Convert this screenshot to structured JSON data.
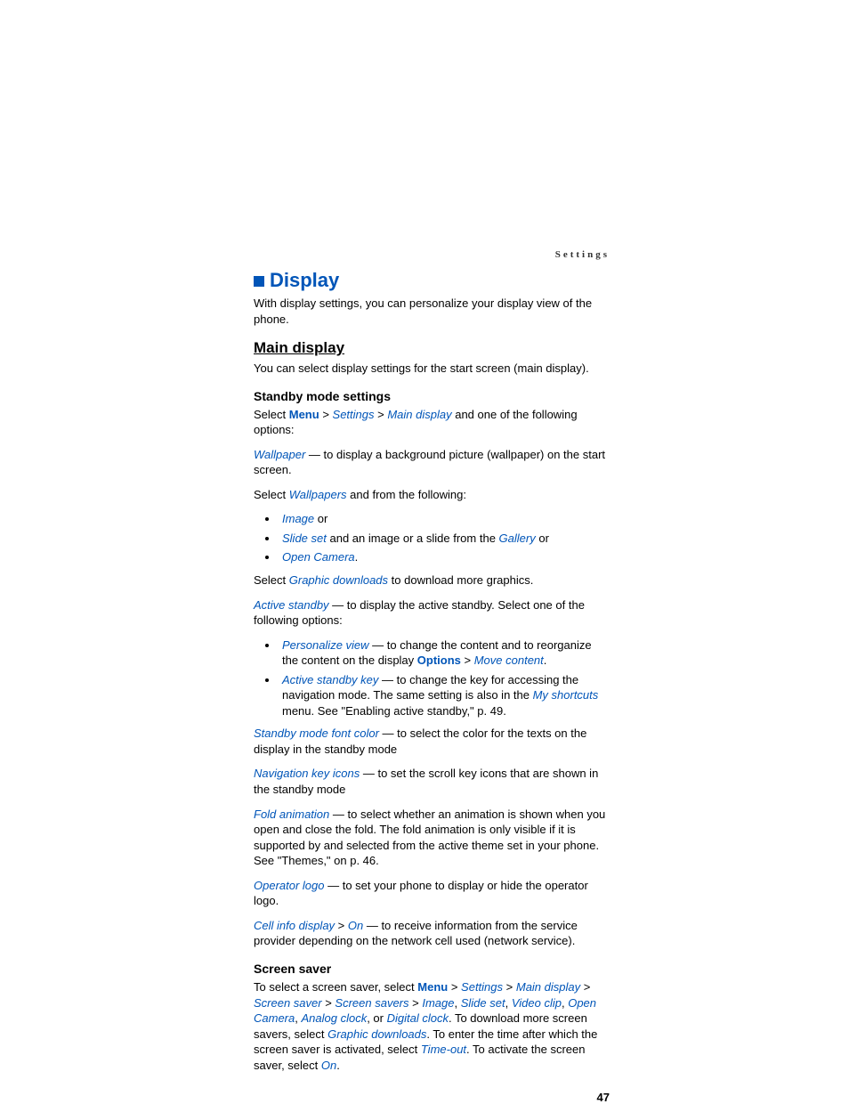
{
  "header": {
    "running": "Settings"
  },
  "title": {
    "main": "Display",
    "intro": "With display settings, you can personalize your display view of the phone."
  },
  "mainDisplay": {
    "heading": "Main display",
    "intro": "You can select display settings for the start screen (main display)."
  },
  "standby": {
    "heading": "Standby mode settings",
    "select_prefix": "Select ",
    "menu": "Menu",
    "settings": "Settings",
    "main_display": "Main display",
    "select_suffix": " and one of the following options:",
    "wallpaper": "Wallpaper",
    "wallpaper_desc": " — to display a background picture (wallpaper) on the start screen.",
    "wallpapers_select_prefix": " Select ",
    "wallpapers": "Wallpapers",
    "wallpapers_select_suffix": " and from the following:",
    "li1_image": "Image",
    "li1_or": " or",
    "li2_slideset": "Slide set",
    "li2_mid": " and an image or a slide from the ",
    "li2_gallery": "Gallery",
    "li2_or": " or",
    "li3_open_camera": "Open Camera",
    "gdl_prefix": "Select ",
    "graphic_downloads": "Graphic downloads",
    "gdl_suffix": " to download more graphics.",
    "active_standby": "Active standby",
    "active_standby_desc": " — to display the active standby. Select one of the following options:",
    "as_li1_pv": "Personalize view",
    "as_li1_mid": " — to change the content and to reorganize the content on the display ",
    "as_li1_options": "Options",
    "as_li1_move": "Move content",
    "as_li2_key": "Active standby key",
    "as_li2_mid": " — to change the key for accessing the navigation mode. The same setting is also in the ",
    "as_li2_shortcuts": "My shortcuts",
    "as_li2_tail": " menu. See \"Enabling active standby,\" p. 49.",
    "sfc": "Standby mode font color",
    "sfc_desc": " — to select the color for the texts on the display in the standby mode",
    "nki": "Navigation key icons",
    "nki_desc": " — to set the scroll key icons that are shown in the standby mode",
    "fa": "Fold animation",
    "fa_desc": " — to select whether an animation is shown when you open and close the fold. The fold animation is only visible if it is supported by and selected from the active theme set in your phone. See \"Themes,\" on p. 46.",
    "ol": "Operator logo",
    "ol_desc": " — to set your phone to display or hide the operator logo.",
    "cid": "Cell info display",
    "cid_on": "On",
    "cid_desc": " — to receive information from the service provider depending on the network cell used (network service)."
  },
  "screensaver": {
    "heading": "Screen saver",
    "prefix": "To select a screen saver, select ",
    "menu": "Menu",
    "settings": "Settings",
    "main_display": "Main display",
    "screen_saver": "Screen saver",
    "screen_savers": "Screen savers",
    "image": "Image",
    "slide_set": "Slide set",
    "video_clip": "Video clip",
    "open_camera": "Open Camera",
    "analog": "Analog clock",
    "or": ", or ",
    "digital": "Digital clock",
    "dl_prefix": ". To download more screen savers, select ",
    "graphic_downloads": "Graphic downloads",
    "time_prefix": ". To enter the time after which the screen saver is activated, select ",
    "timeout": "Time-out",
    "activate_prefix": ". To activate the screen saver, select ",
    "on": "On"
  },
  "page_number": "47"
}
